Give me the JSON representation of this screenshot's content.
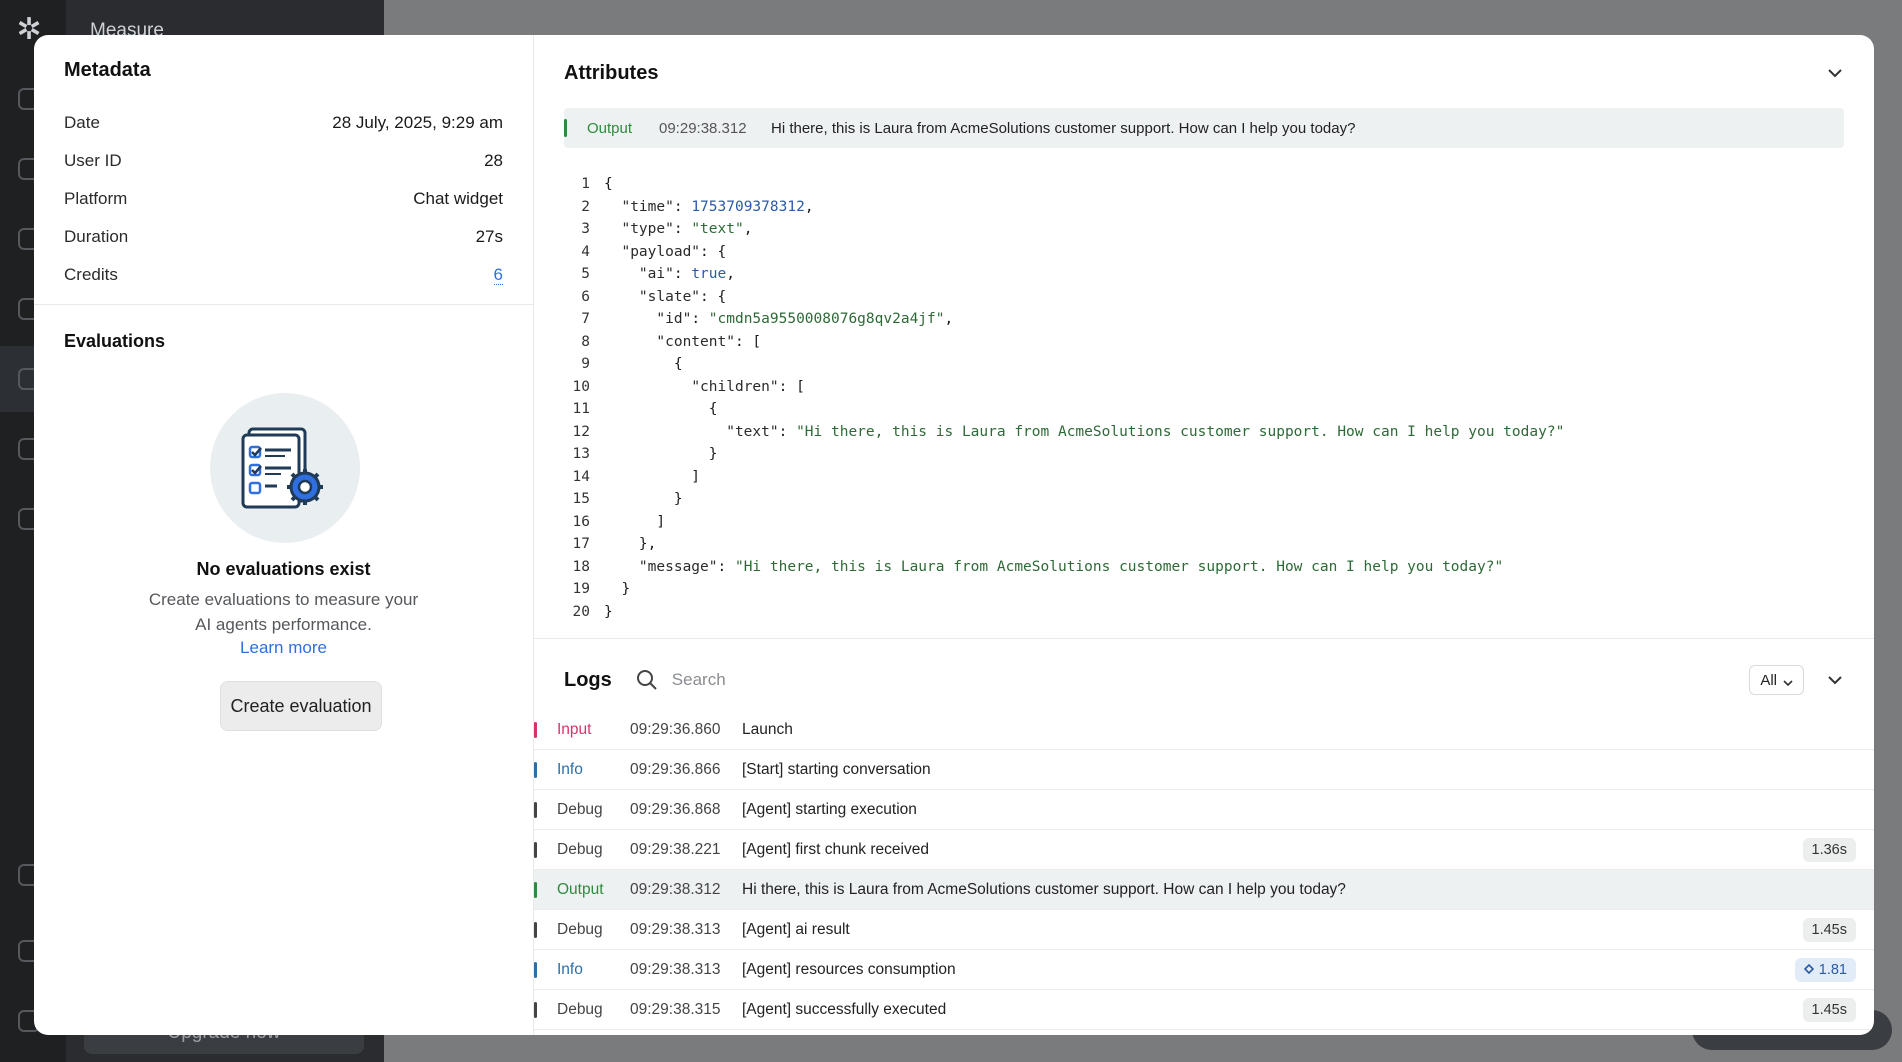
{
  "background": {
    "panel_title": "Measure",
    "upgrade_label": "Upgrade now"
  },
  "metadata": {
    "title": "Metadata",
    "rows": [
      {
        "key": "Date",
        "value": "28 July, 2025, 9:29 am"
      },
      {
        "key": "User ID",
        "value": "28"
      },
      {
        "key": "Platform",
        "value": "Chat widget"
      },
      {
        "key": "Duration",
        "value": "27s"
      },
      {
        "key": "Credits",
        "value": "6"
      }
    ]
  },
  "evaluations": {
    "title": "Evaluations",
    "empty_title": "No evaluations exist",
    "empty_desc": "Create evaluations to measure your AI agents performance.",
    "learn_more": "Learn more",
    "create_button": "Create evaluation"
  },
  "attributes": {
    "title": "Attributes",
    "banner": {
      "level": "Output",
      "timestamp": "09:29:38.312",
      "message": "Hi there, this is Laura from AcmeSolutions customer support. How can I help you today?"
    },
    "code_lines": [
      "{",
      "  \"time\": 1753709378312,",
      "  \"type\": \"text\",",
      "  \"payload\": {",
      "    \"ai\": true,",
      "    \"slate\": {",
      "      \"id\": \"cmdn5a9550008076g8qv2a4jf\",",
      "      \"content\": [",
      "        {",
      "          \"children\": [",
      "            {",
      "              \"text\": \"Hi there, this is Laura from AcmeSolutions customer support. How can I help you today?\"",
      "            }",
      "          ]",
      "        }",
      "      ]",
      "    },",
      "    \"message\": \"Hi there, this is Laura from AcmeSolutions customer support. How can I help you today?\"",
      "  }",
      "}"
    ]
  },
  "logs": {
    "title": "Logs",
    "search_placeholder": "Search",
    "filter_value": "All",
    "level_colors": {
      "Input": "#d6336c",
      "Info": "#2c6fa8",
      "Debug": "#444444",
      "Output": "#2e8b3d"
    },
    "rows": [
      {
        "level": "Input",
        "timestamp": "09:29:36.860",
        "message": "Launch",
        "badge": ""
      },
      {
        "level": "Info",
        "timestamp": "09:29:36.866",
        "message": "[Start] starting conversation",
        "badge": ""
      },
      {
        "level": "Debug",
        "timestamp": "09:29:36.868",
        "message": "[Agent] starting execution",
        "badge": ""
      },
      {
        "level": "Debug",
        "timestamp": "09:29:38.221",
        "message": "[Agent] first chunk received",
        "badge": "1.36s"
      },
      {
        "level": "Output",
        "timestamp": "09:29:38.312",
        "message": "Hi there, this is Laura from AcmeSolutions customer support. How can I help you today?",
        "badge": "",
        "highlighted": true
      },
      {
        "level": "Debug",
        "timestamp": "09:29:38.313",
        "message": "[Agent] ai result",
        "badge": "1.45s"
      },
      {
        "level": "Info",
        "timestamp": "09:29:38.313",
        "message": "[Agent] resources consumption",
        "badge": "1.81",
        "badge_icon": "credits-icon"
      },
      {
        "level": "Debug",
        "timestamp": "09:29:38.315",
        "message": "[Agent] successfully executed",
        "badge": "1.45s"
      }
    ]
  }
}
